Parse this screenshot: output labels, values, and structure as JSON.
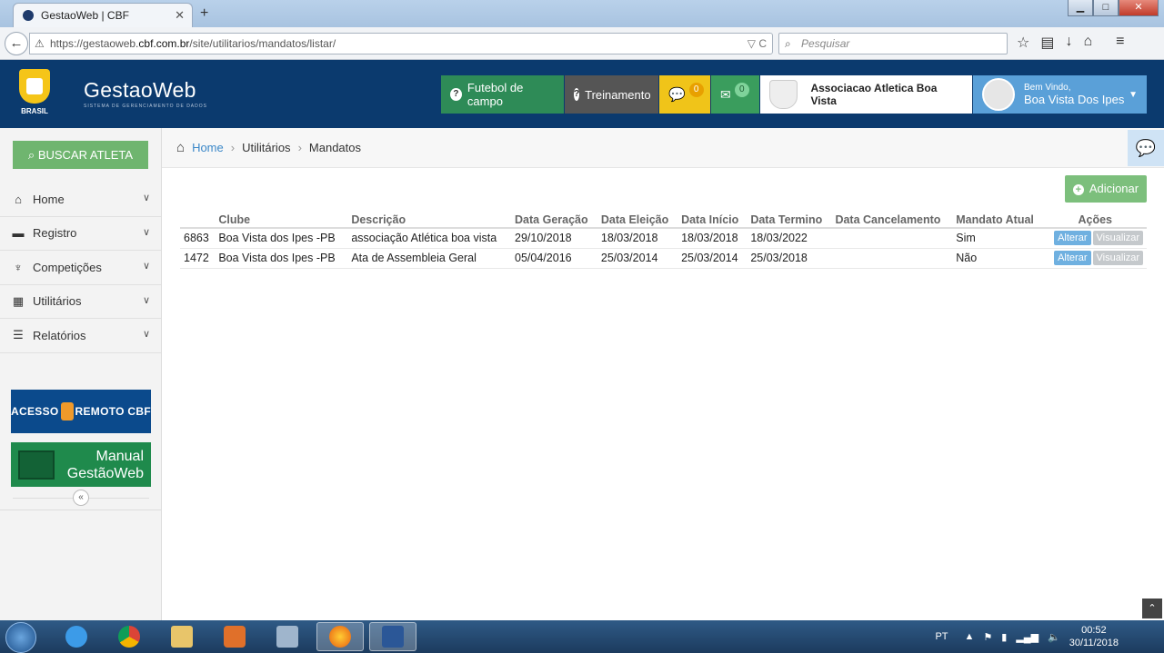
{
  "browser": {
    "tab_title": "GestaoWeb | CBF",
    "new_tab": "+",
    "url_prefix": "https://gestaoweb.",
    "url_domain": "cbf.com.br",
    "url_path": "/site/utilitarios/mandatos/listar/",
    "search_placeholder": "Pesquisar"
  },
  "header": {
    "logo_text": "BRASIL",
    "brand": "GestaoWeb",
    "brand_sub": "SISTEMA DE GERENCIAMENTO DE DADOS",
    "futebol": "Futebol de campo",
    "treinamento": "Treinamento",
    "sms_count": "0",
    "msg_count": "0",
    "club_name": "Associacao Atletica Boa Vista",
    "welcome": "Bem Vindo,",
    "user_name": "Boa Vista Dos Ipes"
  },
  "sidebar": {
    "busca": "BUSCAR ATLETA",
    "items": [
      {
        "label": "Home"
      },
      {
        "label": "Registro"
      },
      {
        "label": "Competições"
      },
      {
        "label": "Utilitários"
      },
      {
        "label": "Relatórios"
      }
    ],
    "acesso_a": "ACESSO",
    "acesso_b": "REMOTO CBF",
    "manual_1": "Manual",
    "manual_2": "GestãoWeb"
  },
  "breadcrumb": {
    "home": "Home",
    "b1": "Utilitários",
    "b2": "Mandatos"
  },
  "actions": {
    "add": "Adicionar"
  },
  "table": {
    "headers": [
      "",
      "Clube",
      "Descrição",
      "Data Geração",
      "Data Eleição",
      "Data Início",
      "Data Termino",
      "Data Cancelamento",
      "Mandato Atual",
      "Ações"
    ],
    "rows": [
      [
        "6863",
        "Boa Vista dos Ipes -PB",
        "associação Atlética boa vista",
        "29/10/2018",
        "18/03/2018",
        "18/03/2018",
        "18/03/2022",
        "",
        "Sim"
      ],
      [
        "1472",
        "Boa Vista dos Ipes -PB",
        "Ata de Assembleia Geral",
        "05/04/2016",
        "25/03/2014",
        "25/03/2014",
        "25/03/2018",
        "",
        "Não"
      ]
    ],
    "alterar": "Alterar",
    "visualizar": "Visualizar"
  },
  "taskbar": {
    "lang": "PT",
    "time": "00:52",
    "date": "30/11/2018"
  },
  "colors": {
    "header_bg": "#0b3a6e",
    "futebol_green": "#2e8b57",
    "user_blue": "#5aa0d8",
    "add_green": "#7cbf7c"
  }
}
